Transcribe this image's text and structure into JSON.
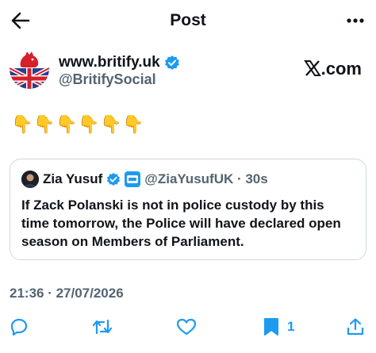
{
  "header": {
    "title": "Post"
  },
  "post": {
    "author_name": "www.britify.uk",
    "author_handle": "@BritifySocial",
    "source_brand": "X.com",
    "source_brand_suffix": ".com",
    "body_emojis": [
      "👇",
      "👇",
      "👇",
      "👇",
      "👇",
      "👇"
    ],
    "timestamp": "21:36 · 27/07/2026"
  },
  "quoted": {
    "name": "Zia Yusuf",
    "handle_time": "@ZiaYusufUK · 30s",
    "text": "If Zack Polanski is not in police custody by this time tomorrow, the Police will have declared open season on Members of Parliament."
  },
  "actions": {
    "bookmark_count": "1"
  },
  "colors": {
    "accent": "#1d9bf0",
    "muted": "#536471",
    "border": "#cfd9de",
    "text": "#0f1419"
  },
  "icons": [
    "back-arrow-icon",
    "more-icon",
    "verified-icon",
    "reply-icon",
    "retweet-icon",
    "like-icon",
    "bookmark-icon",
    "share-icon"
  ]
}
